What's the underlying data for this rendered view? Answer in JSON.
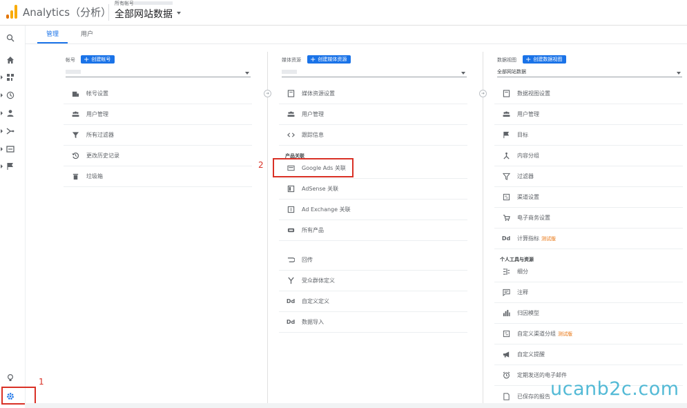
{
  "header": {
    "app_title": "Analytics（分析）",
    "account_crumb": "所有帐号 >",
    "view_name": "全部网站数据",
    "colors": {
      "logo_orange": "#f9ab00",
      "logo_dark": "#e37400"
    }
  },
  "rail": {
    "icons": [
      "search-icon",
      "home-icon",
      "dashboard-icon",
      "clock-icon",
      "person-icon",
      "acquisition-icon",
      "behavior-icon",
      "flag-icon",
      "lightbulb-icon",
      "gear-icon"
    ]
  },
  "tabs": [
    {
      "label": "管理",
      "active": true
    },
    {
      "label": "用户",
      "active": false
    }
  ],
  "account": {
    "header": "帐号",
    "create_label": "创建帐号",
    "items": [
      {
        "icon": "building-icon",
        "label": "帐号设置"
      },
      {
        "icon": "people-icon",
        "label": "用户管理"
      },
      {
        "icon": "filter-icon",
        "label": "所有过滤器"
      },
      {
        "icon": "history-icon",
        "label": "更改历史记录"
      },
      {
        "icon": "trash-icon",
        "label": "垃圾箱"
      }
    ]
  },
  "property": {
    "header": "媒体资源",
    "create_label": "创建媒体资源",
    "items": [
      {
        "icon": "document-icon",
        "label": "媒体资源设置"
      },
      {
        "icon": "people-icon",
        "label": "用户管理"
      },
      {
        "icon": "code-icon",
        "label": "跟踪信息"
      }
    ],
    "product_section": "产品关联",
    "products": [
      {
        "icon": "ads-icon",
        "label": "Google Ads 关联"
      },
      {
        "icon": "adsense-icon",
        "label": "AdSense 关联"
      },
      {
        "icon": "exchange-icon",
        "label": "Ad Exchange 关联"
      },
      {
        "icon": "link-icon",
        "label": "所有产品"
      }
    ],
    "more": [
      {
        "icon": "postback-icon",
        "label": "回传"
      },
      {
        "icon": "audience-icon",
        "label": "受众群体定义"
      },
      {
        "icon": "dd-icon",
        "label": "自定义定义"
      },
      {
        "icon": "dd-icon",
        "label": "数据导入"
      }
    ]
  },
  "view": {
    "header": "数据视图",
    "create_label": "创建数据视图",
    "selected": "全部网站数据",
    "items": [
      {
        "icon": "document-icon",
        "label": "数据视图设置"
      },
      {
        "icon": "people-icon",
        "label": "用户管理"
      },
      {
        "icon": "flag-icon",
        "label": "目标"
      },
      {
        "icon": "grouping-icon",
        "label": "内容分组"
      },
      {
        "icon": "filter-icon",
        "label": "过滤器"
      },
      {
        "icon": "channel-icon",
        "label": "渠道设置"
      },
      {
        "icon": "cart-icon",
        "label": "电子商务设置"
      },
      {
        "icon": "dd-icon",
        "label": "计算指标",
        "badge": "测试版"
      }
    ],
    "personal_section": "个人工具与资源",
    "personal": [
      {
        "icon": "segment-icon",
        "label": "细分"
      },
      {
        "icon": "annotation-icon",
        "label": "注释"
      },
      {
        "icon": "chart-icon",
        "label": "归因模型"
      },
      {
        "icon": "channel-icon",
        "label": "自定义渠道分组",
        "badge": "测试版"
      },
      {
        "icon": "megaphone-icon",
        "label": "自定义提醒"
      },
      {
        "icon": "alarm-icon",
        "label": "定期发送的电子邮件"
      },
      {
        "icon": "saved-report-icon",
        "label": "已保存的报告"
      }
    ]
  },
  "annotations": {
    "one": "1",
    "two": "2"
  },
  "watermark": "ucanb2c.com"
}
